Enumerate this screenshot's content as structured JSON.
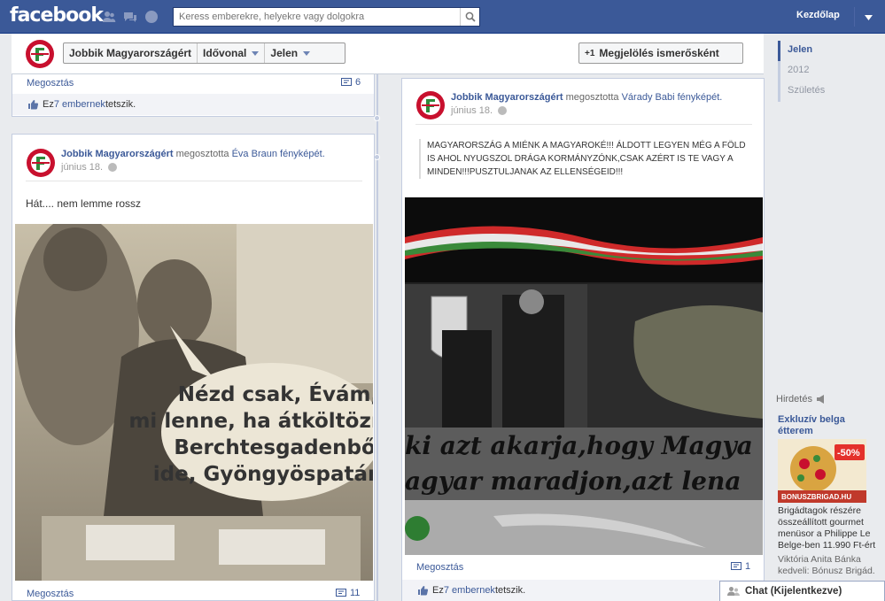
{
  "topbar": {
    "logo": "facebook",
    "search_placeholder": "Keress emberekre, helyekre vagy dolgokra",
    "home": "Kezdőlap"
  },
  "page_header": {
    "page_name": "Jobbik Magyarországért",
    "timeline": "Idővonal",
    "now": "Jelen",
    "mark_friend": "Megjelölés ismerősként"
  },
  "year_nav": [
    "Jelen",
    "2012",
    "Születés"
  ],
  "left_top_card": {
    "share": "Megosztás",
    "comments": "6",
    "likes_prefix": "Ez ",
    "likes_link": "7 embernek",
    "likes_suffix": " tetszik."
  },
  "left_post": {
    "author": "Jobbik Magyarországért",
    "shared_text": " megosztotta ",
    "shared_link": "Éva Braun fényképét.",
    "date": "június 18.",
    "caption": "Hát.... nem lemme rossz",
    "meme_text": [
      "Nézd csak, Évám,",
      "mi lenne, ha átköltöznénk",
      "Berchtesgadenből",
      "ide, Gyöngyöspatára?"
    ],
    "share": "Megosztás",
    "comments": "11"
  },
  "right_post": {
    "author": "Jobbik Magyarországért",
    "shared_text": " megosztotta ",
    "shared_link": "Várady Babi fényképét.",
    "date": "június 18.",
    "quote": "MAGYARORSZÁG A MIÉNK A MAGYAROKÉ!!! ÁLDOTT LEGYEN MÉG A FÖLD IS AHOL NYUGSZOL DRÁGA KORMÁNYZÓNK,CSAK AZÉRT IS TE VAGY A MINDEN!!!PUSZTULJANAK AZ ELLENSÉGEID!!!",
    "image_text_1": "ki azt akarja,hogy Magya",
    "image_text_2": "agyar maradjon,azt lena",
    "share": "Megosztás",
    "comments": "1",
    "likes_prefix": "Ez ",
    "likes_link": "7 embernek",
    "likes_suffix": " tetszik."
  },
  "ad": {
    "header": "Hirdetés",
    "title": "Exkluzív belga étterem",
    "badge": "-50%",
    "brand": "BONUSZBRIGAD.HU",
    "text": "Brigádtagok részére összeállított gourmet menüsor a Philippe Le Belge-ben 11.990 Ft-ért",
    "social": "Viktória Anita Bánka kedveli: Bónusz Brigád."
  },
  "chat": {
    "label": "Chat (Kijelentkezve)"
  },
  "colors": {
    "brand": "#3b5998",
    "link": "#3b5998",
    "background": "#e9ebee"
  }
}
